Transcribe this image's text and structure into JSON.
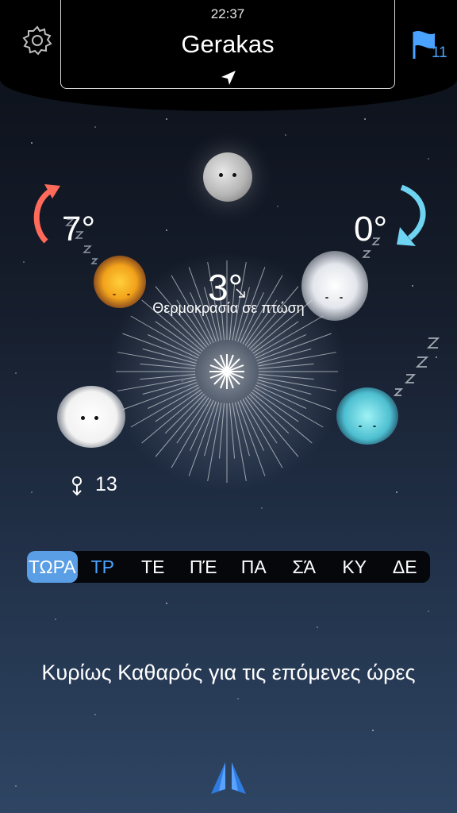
{
  "header": {
    "time": "22:37",
    "city": "Gerakas",
    "favorites_count": "11"
  },
  "forecast": {
    "high_temp": "7°",
    "low_temp": "0°",
    "current_temp": "3°",
    "status": "Θερμοκρασία σε πτώση",
    "wind_speed": "13"
  },
  "days": {
    "tabs": [
      "ΤΩΡΑ",
      "ΤΡ",
      "ΤΕ",
      "ΠΈ",
      "ΠΑ",
      "ΣΆ",
      "ΚΥ",
      "ΔΕ"
    ],
    "selected": "ΤΩΡΑ"
  },
  "summary": "Κυρίως Καθαρός για τις επόμενες ώρες",
  "icons": {
    "settings": "gear-icon",
    "location": "location-arrow-icon",
    "favorites": "flag-icon",
    "temp_up": "arrow-up-curve-icon",
    "temp_down": "arrow-down-curve-icon",
    "wind": "wind-pin-icon",
    "logo": "app-logo-icon"
  },
  "colors": {
    "accent": "#4aa3ff",
    "active_tab": "#5a9ee6",
    "temp_up": "#ff6a5a",
    "temp_down": "#6fd3f2"
  }
}
